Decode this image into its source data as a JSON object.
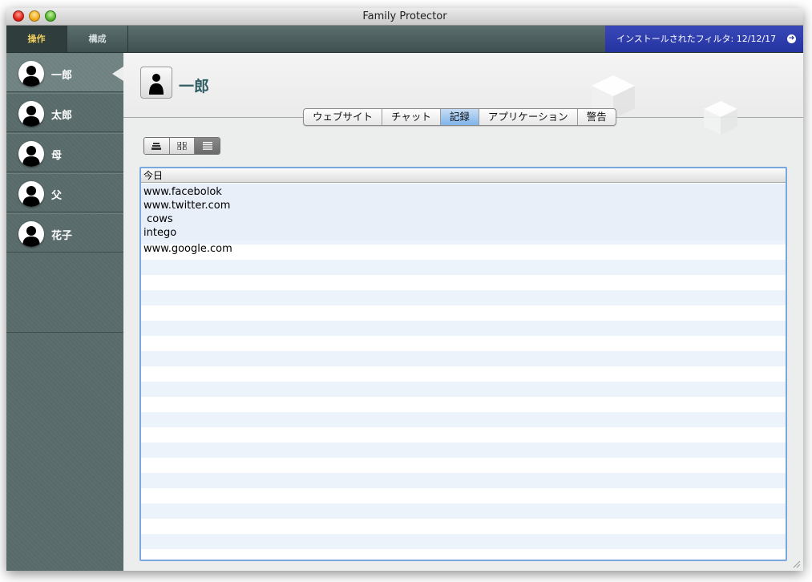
{
  "window": {
    "title": "Family Protector"
  },
  "toolbar": {
    "tabs": [
      {
        "label": "操作",
        "active": true
      },
      {
        "label": "構成",
        "active": false
      }
    ],
    "filter_status": "インストールされたフィルタ: 12/12/17",
    "filter_icon": "arrow-right-circle-icon"
  },
  "sidebar": {
    "users": [
      {
        "name": "一郎",
        "selected": true,
        "icon": "user-silhouette-icon"
      },
      {
        "name": "太郎",
        "selected": false,
        "icon": "user-silhouette-icon"
      },
      {
        "name": "母",
        "selected": false,
        "icon": "user-silhouette-icon"
      },
      {
        "name": "父",
        "selected": false,
        "icon": "user-silhouette-icon"
      },
      {
        "name": "花子",
        "selected": false,
        "icon": "user-silhouette-icon"
      }
    ]
  },
  "header": {
    "user_name": "一郎",
    "tabs": [
      {
        "label": "ウェブサイト",
        "active": false
      },
      {
        "label": "チャット",
        "active": false
      },
      {
        "label": "記録",
        "active": true
      },
      {
        "label": "アプリケーション",
        "active": false
      },
      {
        "label": "警告",
        "active": false
      }
    ]
  },
  "view_switcher": {
    "buttons": [
      {
        "icon": "stack-view-icon",
        "active": false
      },
      {
        "icon": "grid-view-icon",
        "active": false
      },
      {
        "icon": "list-view-icon",
        "active": true
      }
    ]
  },
  "log_table": {
    "column_header": "今日",
    "today_entries": [
      "www.facebolok",
      "www.twitter.com",
      " cows",
      "intego"
    ],
    "other_entries": [
      "www.google.com"
    ]
  },
  "colors": {
    "accent_blue": "#2333a0",
    "sidebar_teal": "#5c6e6e",
    "selected_tab": "#80b4ea",
    "user_name_text": "#2f5f64"
  }
}
